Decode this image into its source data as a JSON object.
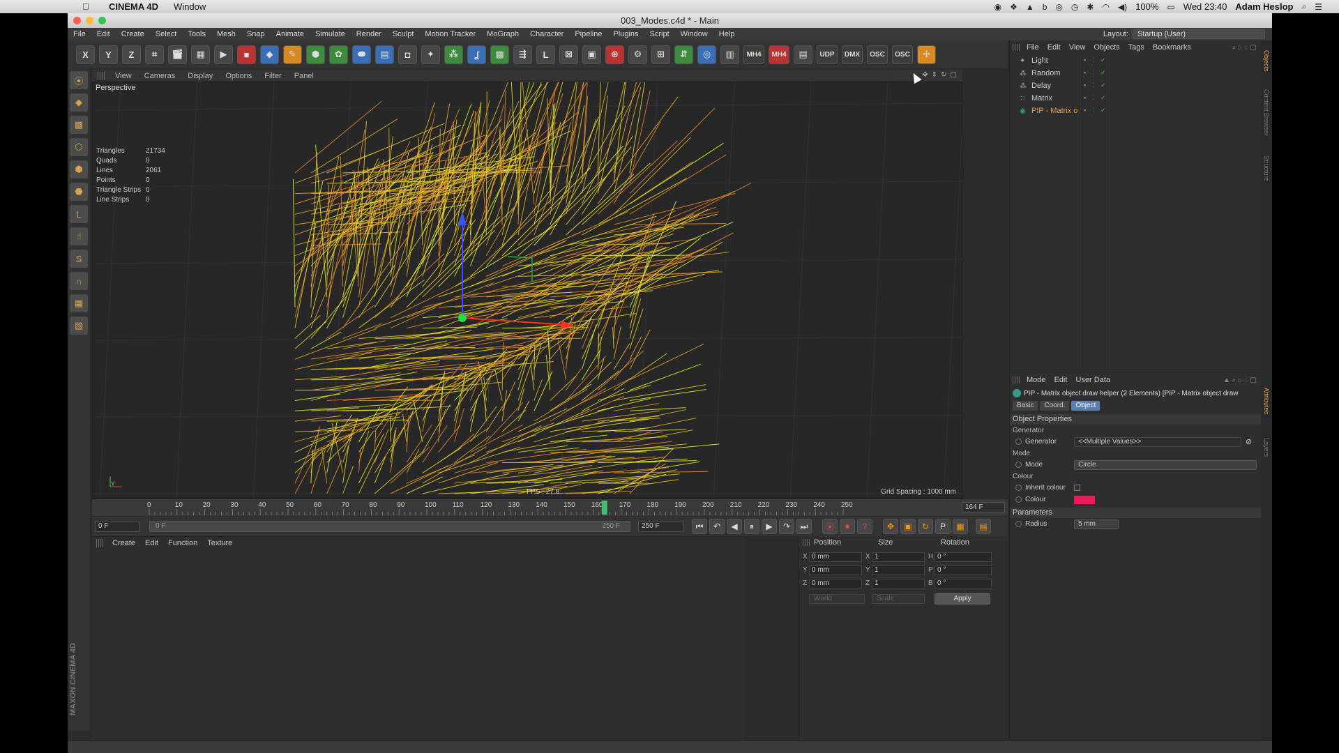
{
  "os_menubar": {
    "app_name": "CINEMA 4D",
    "window_menu": "Window",
    "clock": "Wed 23:40",
    "user": "Adam Heslop",
    "battery": "100%"
  },
  "window": {
    "title": "003_Modes.c4d * - Main"
  },
  "main_menu": [
    "File",
    "Edit",
    "Create",
    "Select",
    "Tools",
    "Mesh",
    "Snap",
    "Animate",
    "Simulate",
    "Render",
    "Sculpt",
    "Motion Tracker",
    "MoGraph",
    "Character",
    "Pipeline",
    "Plugins",
    "Script",
    "Window",
    "Help"
  ],
  "layout": {
    "label": "Layout:",
    "value": "Startup (User)"
  },
  "toolbar": {
    "x": "X",
    "y": "Y",
    "z": "Z",
    "udp": "UDP",
    "dmx": "DMX",
    "osc": "OSC",
    "osc2": "OSC",
    "mh4": "MH4",
    "mh4b": "MH4"
  },
  "viewport": {
    "menu": [
      "View",
      "Cameras",
      "Display",
      "Options",
      "Filter",
      "Panel"
    ],
    "label": "Perspective",
    "stats": [
      {
        "k": "Triangles",
        "v": "21734"
      },
      {
        "k": "Quads",
        "v": "0"
      },
      {
        "k": "Lines",
        "v": "2061"
      },
      {
        "k": "Points",
        "v": "0"
      },
      {
        "k": "Triangle Strips",
        "v": "0"
      },
      {
        "k": "Line Strips",
        "v": "0"
      }
    ],
    "fps": "FPS : 27.8",
    "grid_spacing": "Grid Spacing : 1000 mm",
    "axis_y": "Y"
  },
  "timeline": {
    "ticks": [
      "0",
      "10",
      "20",
      "30",
      "40",
      "50",
      "60",
      "70",
      "80",
      "90",
      "100",
      "110",
      "120",
      "130",
      "140",
      "150",
      "160",
      "170",
      "180",
      "190",
      "200",
      "210",
      "220",
      "230",
      "240",
      "250"
    ],
    "current_frame": "164 F",
    "playhead_fraction": 0.656
  },
  "transport": {
    "start_field": "0 F",
    "slider_start": "0 F",
    "slider_end": "250 F",
    "end_field": "250 F"
  },
  "material_manager": {
    "menu": [
      "Create",
      "Edit",
      "Function",
      "Texture"
    ]
  },
  "coordinates": {
    "headers": {
      "position": "Position",
      "size": "Size",
      "rotation": "Rotation"
    },
    "rows": [
      {
        "axis": "X",
        "pos": "0 mm",
        "size_axis": "X",
        "size": "1",
        "rot_axis": "H",
        "rot": "0 °"
      },
      {
        "axis": "Y",
        "pos": "0 mm",
        "size_axis": "Y",
        "size": "1",
        "rot_axis": "P",
        "rot": "0 °"
      },
      {
        "axis": "Z",
        "pos": "0 mm",
        "size_axis": "Z",
        "size": "1",
        "rot_axis": "B",
        "rot": "0 °"
      }
    ],
    "world": "World",
    "scale": "Scale",
    "apply": "Apply"
  },
  "object_manager": {
    "menu": [
      "File",
      "Edit",
      "View",
      "Objects",
      "Tags",
      "Bookmarks"
    ],
    "objects": [
      {
        "name": "Light",
        "selected": false
      },
      {
        "name": "Random",
        "selected": false
      },
      {
        "name": "Delay",
        "selected": false
      },
      {
        "name": "Matrix",
        "selected": false
      },
      {
        "name": "PIP - Matrix o",
        "selected": true
      }
    ]
  },
  "attributes": {
    "menu": [
      "Mode",
      "Edit",
      "User Data"
    ],
    "title": "PIP - Matrix object draw helper (2 Elements) [PIP - Matrix object draw",
    "tabs": [
      "Basic",
      "Coord.",
      "Object"
    ],
    "active_tab": "Object",
    "object_properties": "Object Properties",
    "generator_group": "Generator",
    "generator_label": "Generator",
    "generator_value": "<<Multiple Values>>",
    "mode_group": "Mode",
    "mode_label": "Mode",
    "mode_value": "Circle",
    "colour_group": "Colour",
    "inherit_label": "Inherit colour",
    "colour_label": "Colour",
    "colour_value": "#f0185a",
    "params_group": "Parameters",
    "radius_label": "Radius",
    "radius_value": "5 mm"
  },
  "side_tabs": [
    "Objects",
    "Content Browser",
    "Structure",
    "Attributes",
    "Layers"
  ],
  "maxon_logo": "MAXON CINEMA 4D"
}
